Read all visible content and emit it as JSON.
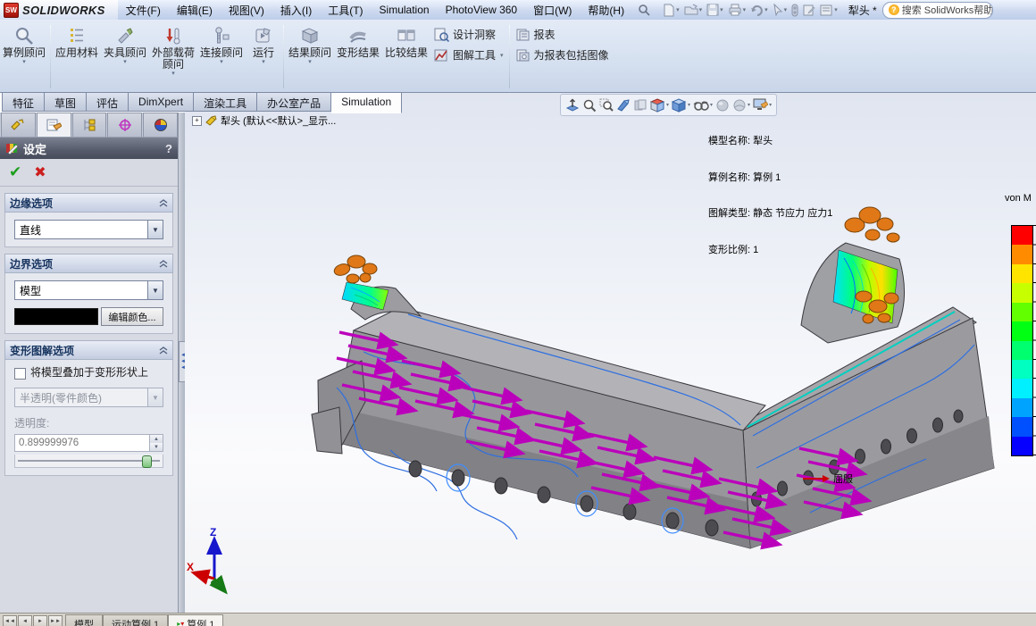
{
  "window": {
    "logo_short": "SW",
    "app_name": "SOLIDWORKS",
    "document_name": "犁头 *",
    "search_text": "搜索 SolidWorks帮助",
    "search_q": "?"
  },
  "menubar": {
    "items": [
      "文件(F)",
      "编辑(E)",
      "视图(V)",
      "插入(I)",
      "工具(T)",
      "Simulation",
      "PhotoView 360",
      "窗口(W)",
      "帮助(H)"
    ]
  },
  "ribbon": {
    "buttons": [
      {
        "label": "算例顾问",
        "dropdown": "▾"
      },
      {
        "label": "应用材料"
      },
      {
        "label": "夹具顾问",
        "dropdown": "▾"
      },
      {
        "label": "外部载荷顾问",
        "dropdown": "▾"
      },
      {
        "label": "连接顾问",
        "dropdown": "▾"
      },
      {
        "label": "运行",
        "dropdown": "▾"
      },
      {
        "label": "结果顾问",
        "dropdown": "▾"
      },
      {
        "label": "变形结果"
      },
      {
        "label": "比较结果"
      }
    ],
    "small_buttons": [
      {
        "label": "设计洞察"
      },
      {
        "label": "图解工具",
        "dropdown": "▾"
      },
      {
        "label": "报表"
      },
      {
        "label": "为报表包括图像"
      }
    ]
  },
  "command_tabs": {
    "items": [
      "特征",
      "草图",
      "评估",
      "DimXpert",
      "渲染工具",
      "办公室产品",
      "Simulation"
    ],
    "active": "Simulation"
  },
  "property_panel": {
    "title": "设定",
    "help": "?",
    "ok": "✔",
    "cancel": "✖",
    "edge_section": {
      "title": "边缘选项",
      "value": "直线"
    },
    "boundary_section": {
      "title": "边界选项",
      "value": "模型",
      "swatch_color": "#000000",
      "edit_button": "编辑颜色..."
    },
    "deform_section": {
      "title": "变形图解选项",
      "checkbox_label": "将模型叠加于变形形状上",
      "checked": false,
      "style_value": "半透明(零件颜色)",
      "transparency_label": "透明度:",
      "transparency_value": "0.899999976"
    }
  },
  "viewport": {
    "tree_root": "犁头 (默认<<默认>_显示...",
    "info_lines": [
      "模型名称: 犁头",
      "算例名称: 算例 1",
      "图解类型: 静态 节应力 应力1",
      "变形比例: 1"
    ],
    "legend": {
      "title": "von M",
      "colors": [
        "#ff0000",
        "#ff8c00",
        "#ffe400",
        "#c8ff00",
        "#62ff00",
        "#00ff12",
        "#00ff6e",
        "#00ffc0",
        "#00f0ff",
        "#00a4ff",
        "#0050ff",
        "#0600ff"
      ],
      "yield_label": "屈服"
    },
    "triad": {
      "x": "X",
      "z": "Z"
    },
    "load_color": "#bb00bb",
    "fixture_color": "#e07818"
  },
  "statusbar": {
    "tabs": [
      "模型",
      "运动算例 1",
      "算例 1"
    ],
    "active": "算例 1"
  }
}
